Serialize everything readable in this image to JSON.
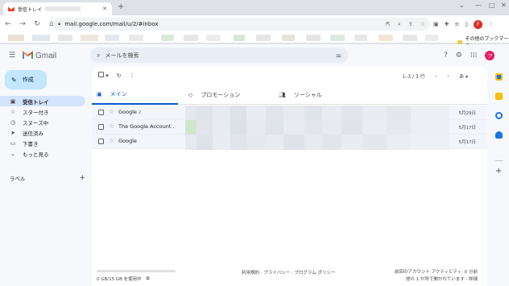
{
  "browser": {
    "tab_title": "受信トレイ",
    "url": "mail.google.com/mail/u/2/#inbox",
    "profile_initial": "F",
    "bookmarks_other": "その他のブックマーク"
  },
  "gmail": {
    "logo_text": "Gmail",
    "search_placeholder": "メールを検索",
    "avatar_initial": "ア",
    "compose_label": "作成",
    "nav": [
      {
        "label": "受信トレイ"
      },
      {
        "label": "スター付き"
      },
      {
        "label": "スヌーズ中"
      },
      {
        "label": "送信済み"
      },
      {
        "label": "下書き"
      },
      {
        "label": "もっと見る"
      }
    ],
    "labels_heading": "ラベル",
    "pager_text": "1–3 / 3 行",
    "input_tool": "あ",
    "tabs": [
      {
        "label": "メイン"
      },
      {
        "label": "プロモーション"
      },
      {
        "label": "ソーシャル"
      }
    ],
    "rows": [
      {
        "sender": "Google",
        "count": "2",
        "date": "5月29日"
      },
      {
        "sender": "The Google Account .",
        "count": "",
        "date": "5月17日"
      },
      {
        "sender": "Google",
        "count": "",
        "date": "5月17日"
      }
    ],
    "storage_text": "0 GB/15 GB を使用中",
    "footer_links": "利用規約 · プライバシー · プログラム ポリシー",
    "activity_line1": "前回のアカウント アクティビティ: 0 分前",
    "activity_line2": "他の 1 か所で開かれています · 詳細"
  },
  "colors": {
    "accent": "#0b57d0",
    "compose_bg": "#c2e7ff",
    "active_nav_bg": "#d3e3fd"
  }
}
